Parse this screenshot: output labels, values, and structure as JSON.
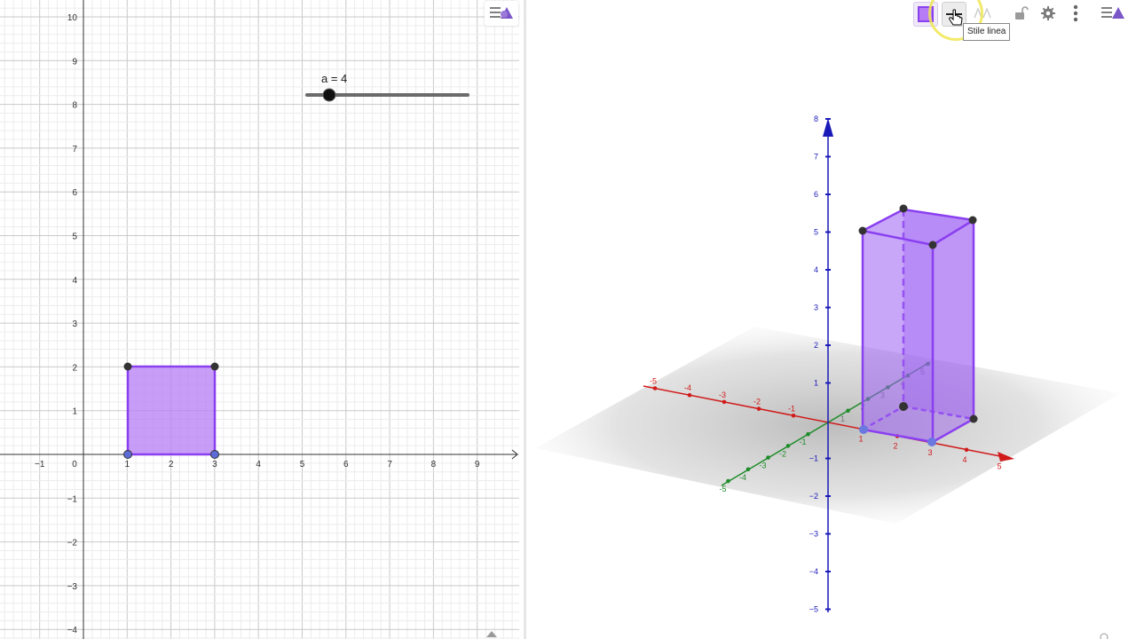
{
  "graphics2d": {
    "x_ticks": [
      "−1",
      "0",
      "1",
      "2",
      "3",
      "4",
      "5",
      "6",
      "7",
      "8",
      "9"
    ],
    "y_ticks": [
      "10",
      "9",
      "8",
      "7",
      "6",
      "5",
      "4",
      "3",
      "2",
      "1",
      "−1",
      "−2",
      "−3",
      "−4"
    ],
    "slider": {
      "label": "a = 4",
      "value": 4
    },
    "square": {
      "vertices": [
        [
          1,
          0
        ],
        [
          3,
          0
        ],
        [
          3,
          2
        ],
        [
          1,
          2
        ]
      ],
      "fill": "#b57cf5",
      "stroke": "#8a3ff0"
    }
  },
  "graphics3d": {
    "z_ticks": [
      "8",
      "7",
      "6",
      "5",
      "4",
      "3",
      "2",
      "1",
      "−1",
      "−2",
      "−3",
      "−4",
      "−5"
    ],
    "x_ticks": [
      "-5",
      "-4",
      "-3",
      "-2",
      "-1",
      "1",
      "2",
      "3",
      "4",
      "5"
    ],
    "y_ticks": [
      "-5",
      "-4",
      "-3",
      "-2",
      "-1",
      "1",
      "2",
      "3",
      "4",
      "5"
    ],
    "x_axis_color": "#d11a1a",
    "y_axis_color": "#1f8c2a",
    "z_axis_color": "#1a1ab8",
    "prism_color": "#9b5cf2"
  },
  "stylebar": {
    "tooltip": "Stile linea",
    "icons": [
      "color-icon",
      "line-style-icon",
      "text-style-icon",
      "lock-icon",
      "settings-icon",
      "more-menu-icon",
      "stylebar-toggle-icon"
    ]
  },
  "colors": {
    "accent": "#8a3ff0",
    "point_dark": "#333333",
    "point_blue": "#5c6bd6"
  }
}
